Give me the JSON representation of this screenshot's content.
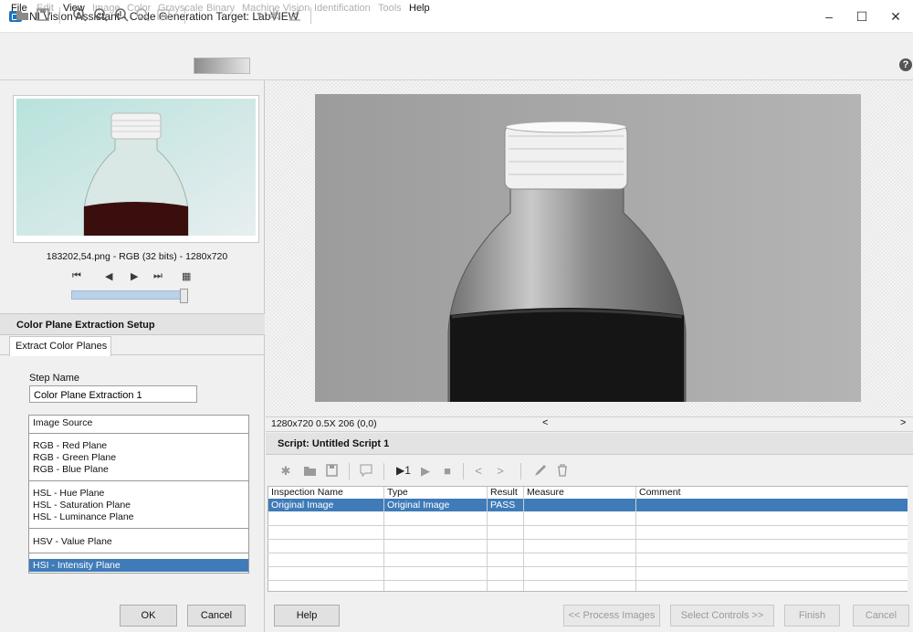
{
  "window": {
    "title": "NI Vision Assistant - Code Generation Target: LabVIEW",
    "minimize": "–",
    "maximize": "☐",
    "close": "✕"
  },
  "menu": [
    {
      "label": "File",
      "enabled": true
    },
    {
      "label": "Edit",
      "enabled": false
    },
    {
      "label": "View",
      "enabled": true
    },
    {
      "label": "Image",
      "enabled": false
    },
    {
      "label": "Color",
      "enabled": false
    },
    {
      "label": "Grayscale",
      "enabled": false
    },
    {
      "label": "Binary",
      "enabled": false
    },
    {
      "label": "Machine Vision",
      "enabled": false
    },
    {
      "label": "Identification",
      "enabled": false
    },
    {
      "label": "Tools",
      "enabled": false
    },
    {
      "label": "Help",
      "enabled": true
    }
  ],
  "toolbar": {
    "icons": [
      "open-icon",
      "save-icon",
      "zoom-in-icon",
      "zoom-out-icon",
      "zoom-1to1-icon",
      "zoom-fit-icon",
      "image-fit-icon",
      "palette-dropdown",
      "threshold-icon",
      "measure-icon",
      "help-icon"
    ],
    "help_glyph": "?"
  },
  "browser": {
    "caption": "183202,54.png - RGB (32 bits) - 1280x720",
    "nav": [
      "⏮",
      "◀",
      "▶",
      "⏭",
      "▦"
    ],
    "slider_fraction": 1.0
  },
  "setup": {
    "header": "Color Plane Extraction Setup",
    "tab": "Extract Color Planes",
    "step_name_label": "Step Name",
    "step_name_value": "Color Plane Extraction 1",
    "source_header": "Image Source",
    "source_groups": [
      [
        "RGB - Red Plane",
        "RGB - Green Plane",
        "RGB - Blue Plane"
      ],
      [
        "HSL - Hue Plane",
        "HSL - Saturation Plane",
        "HSL - Luminance Plane"
      ],
      [
        "HSV - Value Plane"
      ],
      [
        "HSI - Intensity Plane"
      ]
    ],
    "selected": "HSI - Intensity Plane",
    "ok": "OK",
    "cancel": "Cancel"
  },
  "viewer": {
    "status": "1280x720 0.5X 206   (0,0)",
    "scroll_left": "<",
    "scroll_right": ">"
  },
  "script": {
    "header": "Script: Untitled Script 1",
    "toolbar_icons": [
      "new-step-icon",
      "open-script-icon",
      "save-script-icon",
      "comment-icon",
      "run-once-icon",
      "run-icon",
      "stop-icon",
      "step-back-icon",
      "step-forward-icon",
      "edit-step-icon",
      "delete-step-icon"
    ],
    "columns": [
      "Inspection Name",
      "Type",
      "Result",
      "Measure",
      "Comment"
    ],
    "rows": [
      {
        "name": "Original Image",
        "type": "Original Image",
        "result": "PASS",
        "measure": "",
        "comment": ""
      }
    ]
  },
  "bottom": {
    "help": "Help",
    "process": "<< Process Images",
    "select_controls": "Select Controls >>",
    "finish": "Finish",
    "cancel": "Cancel"
  },
  "colors": {
    "selection": "#3f7bb8",
    "title_icon": "#1e73be"
  }
}
